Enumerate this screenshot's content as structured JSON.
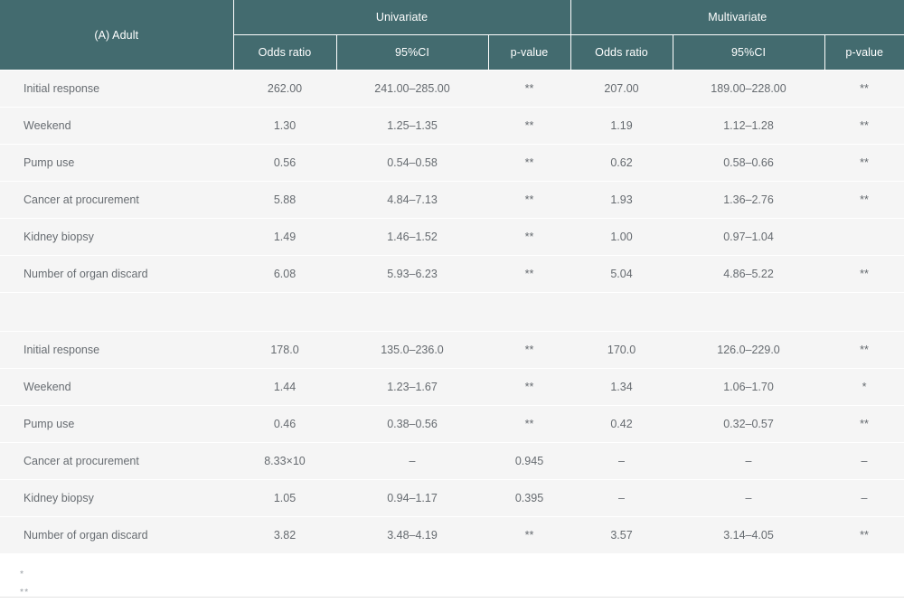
{
  "table": {
    "corner_label": "(A) Adult",
    "groups": [
      {
        "label": "Univariate"
      },
      {
        "label": "Multivariate"
      }
    ],
    "subheaders": {
      "odds_ratio": "Odds ratio",
      "ci": "95%CI",
      "p_value": "p-value"
    },
    "blocks": [
      {
        "rows": [
          {
            "label": "Initial response",
            "uni_or": "262.00",
            "uni_ci": "241.00–285.00",
            "uni_p": "**",
            "multi_or": "207.00",
            "multi_ci": "189.00–228.00",
            "multi_p": "**"
          },
          {
            "label": "Weekend",
            "uni_or": "1.30",
            "uni_ci": "1.25–1.35",
            "uni_p": "**",
            "multi_or": "1.19",
            "multi_ci": "1.12–1.28",
            "multi_p": "**"
          },
          {
            "label": "Pump use",
            "uni_or": "0.56",
            "uni_ci": "0.54–0.58",
            "uni_p": "**",
            "multi_or": "0.62",
            "multi_ci": "0.58–0.66",
            "multi_p": "**"
          },
          {
            "label": "Cancer at procurement",
            "uni_or": "5.88",
            "uni_ci": "4.84–7.13",
            "uni_p": "**",
            "multi_or": "1.93",
            "multi_ci": "1.36–2.76",
            "multi_p": "**"
          },
          {
            "label": "Kidney biopsy",
            "uni_or": "1.49",
            "uni_ci": "1.46–1.52",
            "uni_p": "**",
            "multi_or": "1.00",
            "multi_ci": "0.97–1.04",
            "multi_p": ""
          },
          {
            "label": "Number of organ discard",
            "uni_or": "6.08",
            "uni_ci": "5.93–6.23",
            "uni_p": "**",
            "multi_or": "5.04",
            "multi_ci": "4.86–5.22",
            "multi_p": "**"
          }
        ]
      },
      {
        "rows": [
          {
            "label": "Initial response",
            "uni_or": "178.0",
            "uni_ci": "135.0–236.0",
            "uni_p": "**",
            "multi_or": "170.0",
            "multi_ci": "126.0–229.0",
            "multi_p": "**"
          },
          {
            "label": "Weekend",
            "uni_or": "1.44",
            "uni_ci": "1.23–1.67",
            "uni_p": "**",
            "multi_or": "1.34",
            "multi_ci": "1.06–1.70",
            "multi_p": "*"
          },
          {
            "label": "Pump use",
            "uni_or": "0.46",
            "uni_ci": "0.38–0.56",
            "uni_p": "**",
            "multi_or": "0.42",
            "multi_ci": "0.32–0.57",
            "multi_p": "**"
          },
          {
            "label": "Cancer at procurement",
            "uni_or": "8.33×10",
            "uni_ci": "–",
            "uni_p": "0.945",
            "multi_or": "–",
            "multi_ci": "–",
            "multi_p": "–"
          },
          {
            "label": "Kidney biopsy",
            "uni_or": "1.05",
            "uni_ci": "0.94–1.17",
            "uni_p": "0.395",
            "multi_or": "–",
            "multi_ci": "–",
            "multi_p": "–"
          },
          {
            "label": "Number of organ discard",
            "uni_or": "3.82",
            "uni_ci": "3.48–4.19",
            "uni_p": "**",
            "multi_or": "3.57",
            "multi_ci": "3.14–4.05",
            "multi_p": "**"
          }
        ]
      }
    ],
    "separator_row": {
      "label": "",
      "uni_or": "",
      "uni_ci": "",
      "uni_p": "",
      "multi_or": "",
      "multi_ci": "",
      "multi_p": ""
    }
  },
  "footnotes": [
    {
      "marker": "*"
    },
    {
      "marker": "**"
    }
  ],
  "colors": {
    "header_bg": "#436b6f",
    "header_text": "#ffffff",
    "row_bg": "#f5f5f5",
    "row_text": "#666b70",
    "divider": "#ffffff",
    "bottom_rule": "#e3e3e3"
  }
}
